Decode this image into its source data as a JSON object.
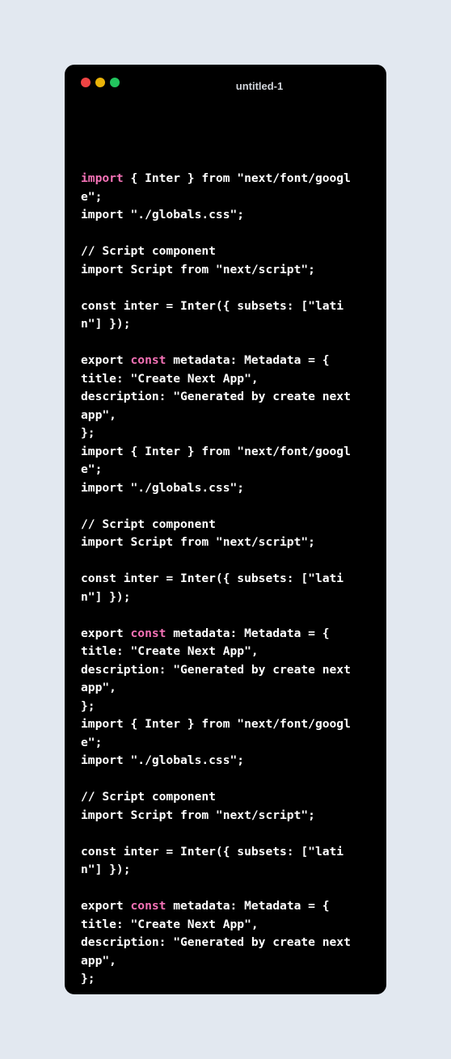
{
  "window": {
    "title": "untitled-1"
  },
  "code": {
    "lines": [
      [
        {
          "t": "import",
          "kw": true
        },
        {
          "t": " { Inter } from \"next/font/googl"
        }
      ],
      [
        {
          "t": "e\";"
        }
      ],
      [
        {
          "t": "import \"./globals.css\";"
        }
      ],
      [
        {
          "t": ""
        }
      ],
      [
        {
          "t": "// Script component"
        }
      ],
      [
        {
          "t": "import Script from \"next/script\";"
        }
      ],
      [
        {
          "t": ""
        }
      ],
      [
        {
          "t": "const inter = Inter({ subsets: [\"lati"
        }
      ],
      [
        {
          "t": "n\"] });"
        }
      ],
      [
        {
          "t": ""
        }
      ],
      [
        {
          "t": "export "
        },
        {
          "t": "const",
          "kw": true
        },
        {
          "t": " metadata: Metadata = {"
        }
      ],
      [
        {
          "t": "title: \"Create Next App\","
        }
      ],
      [
        {
          "t": "description: \"Generated by create next"
        }
      ],
      [
        {
          "t": "app\","
        }
      ],
      [
        {
          "t": "};"
        }
      ],
      [
        {
          "t": "import { Inter } from \"next/font/googl"
        }
      ],
      [
        {
          "t": "e\";"
        }
      ],
      [
        {
          "t": "import \"./globals.css\";"
        }
      ],
      [
        {
          "t": ""
        }
      ],
      [
        {
          "t": "// Script component"
        }
      ],
      [
        {
          "t": "import Script from \"next/script\";"
        }
      ],
      [
        {
          "t": ""
        }
      ],
      [
        {
          "t": "const inter = Inter({ subsets: [\"lati"
        }
      ],
      [
        {
          "t": "n\"] });"
        }
      ],
      [
        {
          "t": ""
        }
      ],
      [
        {
          "t": "export "
        },
        {
          "t": "const",
          "kw": true
        },
        {
          "t": " metadata: Metadata = {"
        }
      ],
      [
        {
          "t": "title: \"Create Next App\","
        }
      ],
      [
        {
          "t": "description: \"Generated by create next"
        }
      ],
      [
        {
          "t": "app\","
        }
      ],
      [
        {
          "t": "};"
        }
      ],
      [
        {
          "t": "import { Inter } from \"next/font/googl"
        }
      ],
      [
        {
          "t": "e\";"
        }
      ],
      [
        {
          "t": "import \"./globals.css\";"
        }
      ],
      [
        {
          "t": ""
        }
      ],
      [
        {
          "t": "// Script component"
        }
      ],
      [
        {
          "t": "import Script from \"next/script\";"
        }
      ],
      [
        {
          "t": ""
        }
      ],
      [
        {
          "t": "const inter = Inter({ subsets: [\"lati"
        }
      ],
      [
        {
          "t": "n\"] });"
        }
      ],
      [
        {
          "t": ""
        }
      ],
      [
        {
          "t": "export "
        },
        {
          "t": "const",
          "kw": true
        },
        {
          "t": " metadata: Metadata = {"
        }
      ],
      [
        {
          "t": "title: \"Create Next App\","
        }
      ],
      [
        {
          "t": "description: \"Generated by create next"
        }
      ],
      [
        {
          "t": "app\","
        }
      ],
      [
        {
          "t": "};"
        }
      ]
    ]
  },
  "colors": {
    "page_background": "#e2e8f0",
    "window_background": "#000000",
    "code_text": "#ffffff",
    "keyword": "#f472b6",
    "dot_close": "#ef4444",
    "dot_minimize": "#eab308",
    "dot_maximize": "#22c55e"
  }
}
